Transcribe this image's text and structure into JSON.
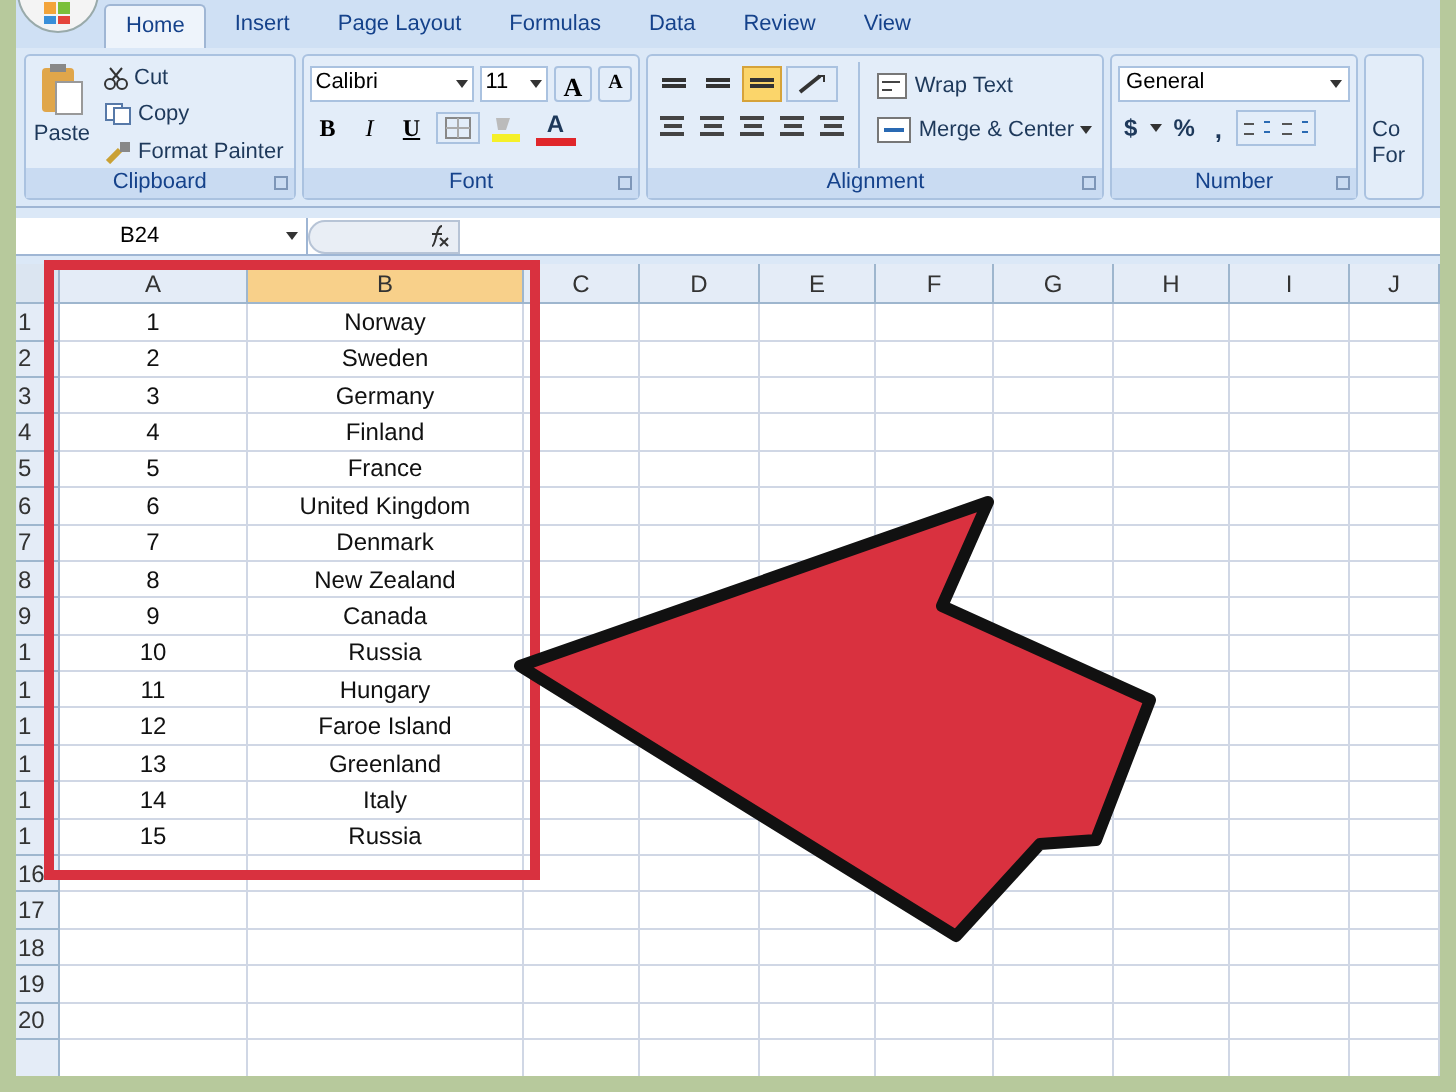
{
  "tabs": [
    {
      "label": "Home",
      "selected": true
    },
    {
      "label": "Insert",
      "selected": false
    },
    {
      "label": "Page Layout",
      "selected": false
    },
    {
      "label": "Formulas",
      "selected": false
    },
    {
      "label": "Data",
      "selected": false
    },
    {
      "label": "Review",
      "selected": false
    },
    {
      "label": "View",
      "selected": false
    }
  ],
  "clipboard": {
    "paste": "Paste",
    "cut": "Cut",
    "copy": "Copy",
    "format_painter": "Format Painter",
    "label": "Clipboard"
  },
  "font": {
    "name": "Calibri",
    "size": "11",
    "grow": "A",
    "shrink": "A",
    "bold": "B",
    "italic": "I",
    "underline": "U",
    "color_letter": "A",
    "label": "Font"
  },
  "alignment": {
    "vertical": [
      {
        "selected": false
      },
      {
        "selected": false
      },
      {
        "selected": true
      }
    ],
    "wrap_text": "Wrap Text",
    "merge_center": "Merge & Center",
    "label": "Alignment"
  },
  "number": {
    "format": "General",
    "currency": "$",
    "percent": "%",
    "comma": ",",
    "label": "Number"
  },
  "cut_group": {
    "line_1": "Co",
    "line_2": "For"
  },
  "name_box": "B24",
  "columns": [
    {
      "label": "A",
      "selected": false
    },
    {
      "label": "B",
      "selected": true
    },
    {
      "label": "C",
      "selected": false
    },
    {
      "label": "D",
      "selected": false
    },
    {
      "label": "E",
      "selected": false
    },
    {
      "label": "F",
      "selected": false
    },
    {
      "label": "G",
      "selected": false
    },
    {
      "label": "H",
      "selected": false
    },
    {
      "label": "I",
      "selected": false
    },
    {
      "label": "J",
      "selected": false
    }
  ],
  "rows": [
    {
      "number": "1",
      "cells": [
        "1",
        "Norway"
      ]
    },
    {
      "number": "2",
      "cells": [
        "2",
        "Sweden"
      ]
    },
    {
      "number": "3",
      "cells": [
        "3",
        "Germany"
      ]
    },
    {
      "number": "4",
      "cells": [
        "4",
        "Finland"
      ]
    },
    {
      "number": "5",
      "cells": [
        "5",
        "France"
      ]
    },
    {
      "number": "6",
      "cells": [
        "6",
        "United Kingdom"
      ]
    },
    {
      "number": "7",
      "cells": [
        "7",
        "Denmark"
      ]
    },
    {
      "number": "8",
      "cells": [
        "8",
        "New Zealand"
      ]
    },
    {
      "number": "9",
      "cells": [
        "9",
        "Canada"
      ]
    },
    {
      "number": "1",
      "cells": [
        "10",
        "Russia"
      ]
    },
    {
      "number": "1",
      "cells": [
        "11",
        "Hungary"
      ]
    },
    {
      "number": "1",
      "cells": [
        "12",
        "Faroe Island"
      ]
    },
    {
      "number": "1",
      "cells": [
        "13",
        "Greenland"
      ]
    },
    {
      "number": "1",
      "cells": [
        "14",
        "Italy"
      ]
    },
    {
      "number": "1",
      "cells": [
        "15",
        "Russia"
      ]
    },
    {
      "number": "16",
      "cells": []
    },
    {
      "number": "17",
      "cells": []
    },
    {
      "number": "18",
      "cells": []
    },
    {
      "number": "19",
      "cells": []
    },
    {
      "number": "20",
      "cells": []
    }
  ]
}
